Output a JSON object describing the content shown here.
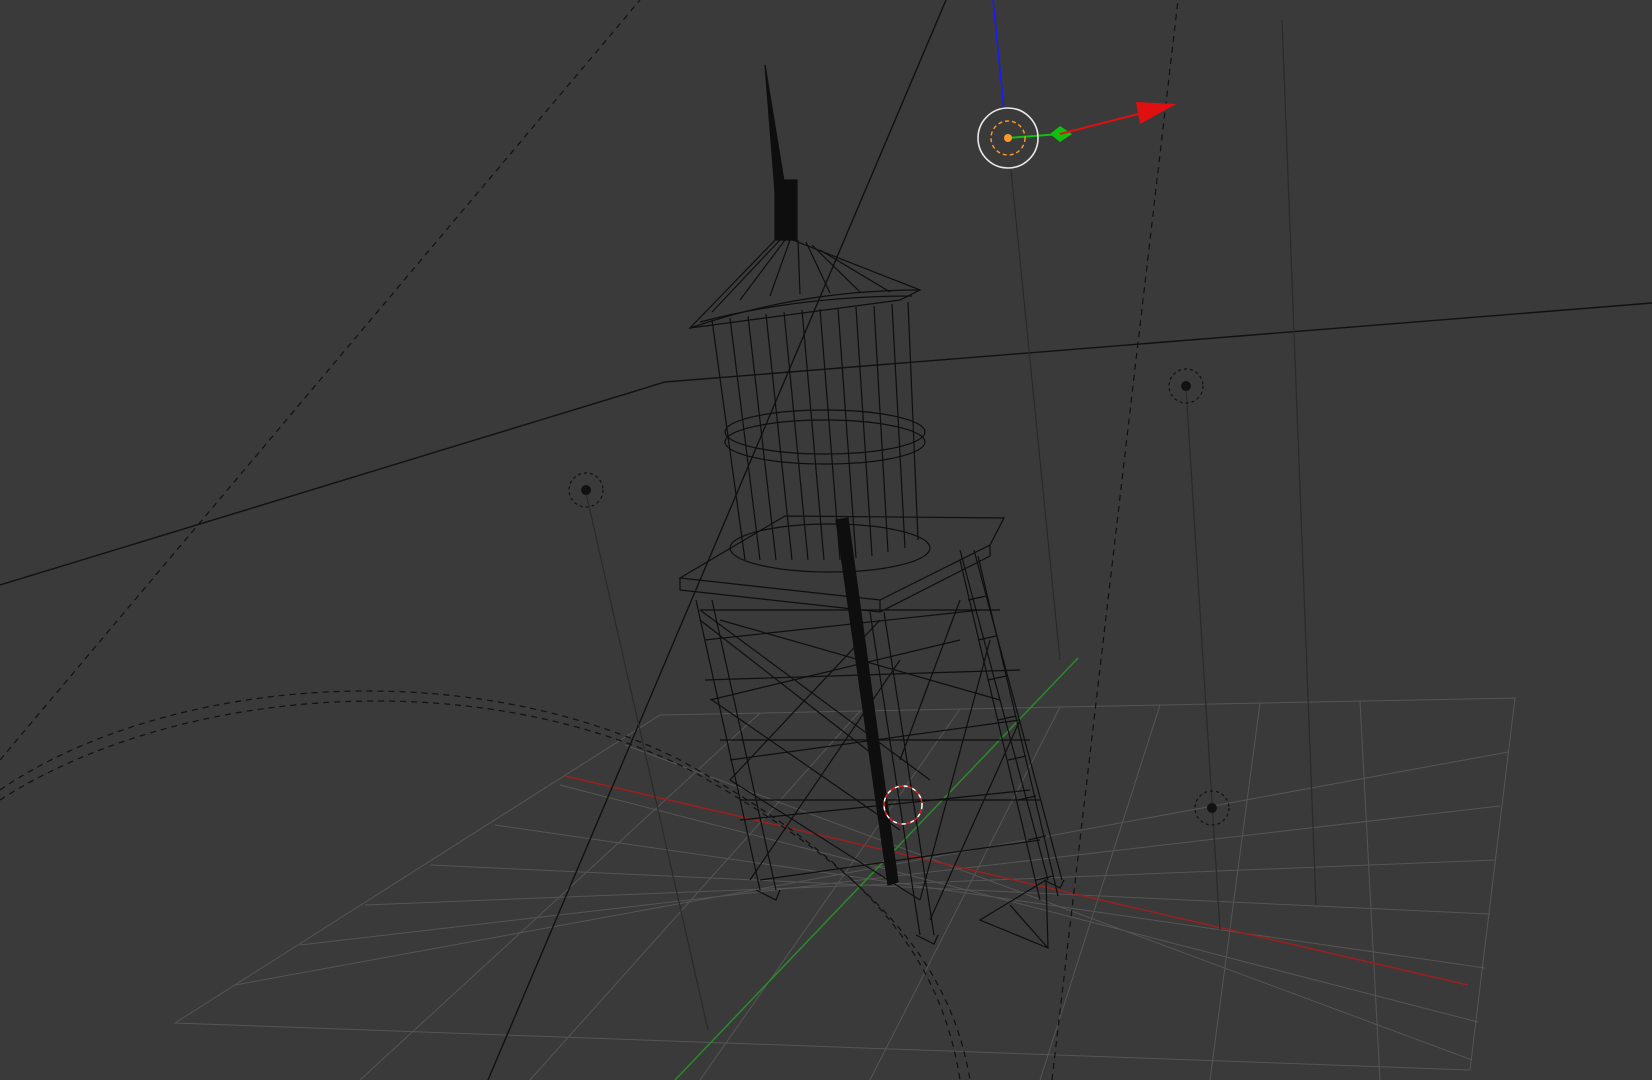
{
  "viewport": {
    "mode": "3D View",
    "shading": "wireframe",
    "background": "#3a3a3a"
  },
  "colors": {
    "grid": "#555555",
    "x_axis": "#9a2020",
    "y_axis": "#2a8a2a",
    "z_axis": "#1a1aff",
    "wire": "#0e0e0e",
    "selected_origin": "#ff9a2a",
    "gizmo_x": "#e01010",
    "gizmo_y": "#10c010"
  },
  "scene": {
    "selected_object": "water-tower",
    "lamps": [
      "lamp",
      "lamp",
      "lamp"
    ],
    "camera_guides": true,
    "cursor_3d": true
  }
}
